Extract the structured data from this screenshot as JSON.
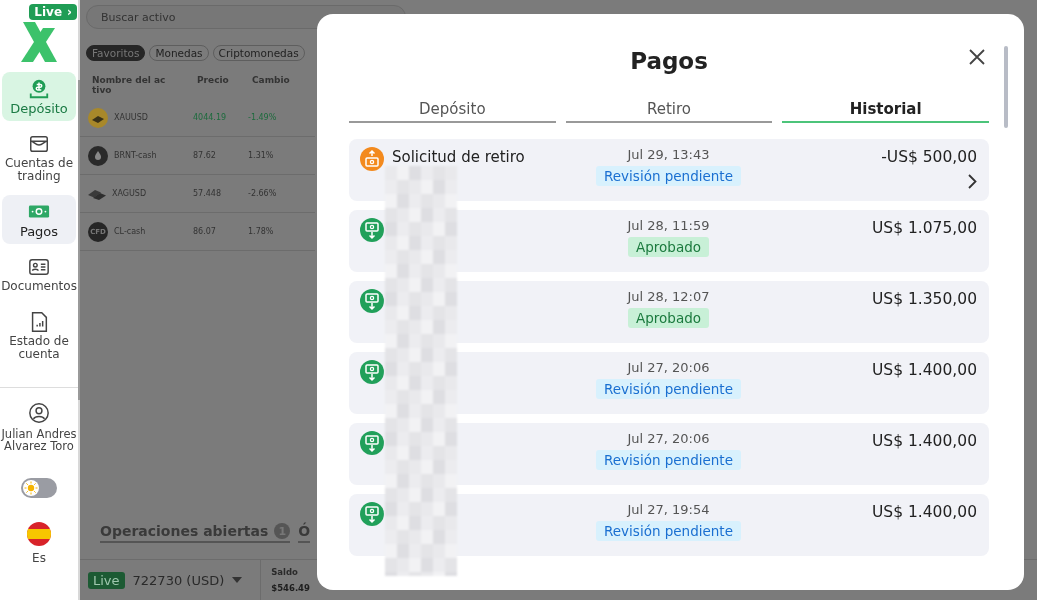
{
  "sidebar": {
    "logo": {
      "badge": "Live",
      "chevron": "›"
    },
    "items": [
      {
        "label": "Depósito",
        "selected": true,
        "hovered": false
      },
      {
        "label": "Cuentas de trading",
        "selected": false,
        "hovered": false
      },
      {
        "label": "Pagos",
        "selected": false,
        "hovered": true
      },
      {
        "label": "Documentos",
        "selected": false,
        "hovered": false
      },
      {
        "label": "Estado de cuenta",
        "selected": false,
        "hovered": false
      }
    ],
    "user": {
      "name": "Julian Andres Alvarez Toro"
    },
    "theme_toggle": {
      "on": false
    },
    "language": {
      "label": "Es"
    }
  },
  "market": {
    "search": {
      "placeholder": "Buscar activo"
    },
    "chips": [
      {
        "label": "Favoritos",
        "selected": true
      },
      {
        "label": "Monedas",
        "selected": false
      },
      {
        "label": "Criptomonedas",
        "selected": false
      }
    ],
    "columns": [
      "Nombre del activo",
      "Precio",
      "Cambio"
    ],
    "rows": [
      {
        "name": "XAUUSD",
        "price": "4044.19",
        "change": "-1.49%",
        "highlight": true
      },
      {
        "name": "BRNT-cash",
        "price": "87.62",
        "change": "1.31%",
        "highlight": false
      },
      {
        "name": "XAGUSD",
        "price": "57.448",
        "change": "-2.66%",
        "highlight": false
      },
      {
        "icon_text": "CFD",
        "name": "CL-cash",
        "price": "86.07",
        "change": "1.78%",
        "highlight": false
      }
    ],
    "bottom_tabs": [
      {
        "label": "Operaciones abiertas",
        "badge": "1"
      },
      {
        "label": "Ó"
      }
    ],
    "account": {
      "badge": "Live",
      "number": "722730 (USD)",
      "balance_label": "Saldo",
      "balance": "$546.49"
    }
  },
  "modal": {
    "title": "Pagos",
    "tabs": [
      {
        "label": "Depósito",
        "selected": false
      },
      {
        "label": "Retiro",
        "selected": false
      },
      {
        "label": "Historial",
        "selected": true
      }
    ],
    "transactions": [
      {
        "kind": "withdrawal",
        "title": "Solicitud de retiro",
        "date": "Jul 29, 13:43",
        "status": {
          "label": "Revisión pendiente",
          "kind": "pending"
        },
        "amount": "-US$ 500,00",
        "has_details": true
      },
      {
        "kind": "deposit",
        "date": "Jul 28, 11:59",
        "status": {
          "label": "Aprobado",
          "kind": "approved"
        },
        "amount": "US$ 1.075,00",
        "has_details": false
      },
      {
        "kind": "deposit",
        "date": "Jul 28, 12:07",
        "status": {
          "label": "Aprobado",
          "kind": "approved"
        },
        "amount": "US$ 1.350,00",
        "has_details": false
      },
      {
        "kind": "deposit",
        "date": "Jul 27, 20:06",
        "status": {
          "label": "Revisión pendiente",
          "kind": "pending"
        },
        "amount": "US$ 1.400,00",
        "has_details": false
      },
      {
        "kind": "deposit",
        "date": "Jul 27, 20:06",
        "status": {
          "label": "Revisión pendiente",
          "kind": "pending"
        },
        "amount": "US$ 1.400,00",
        "has_details": false
      },
      {
        "kind": "deposit",
        "date": "Jul 27, 19:54",
        "status": {
          "label": "Revisión pendiente",
          "kind": "pending"
        },
        "amount": "US$ 1.400,00",
        "has_details": false
      }
    ]
  }
}
